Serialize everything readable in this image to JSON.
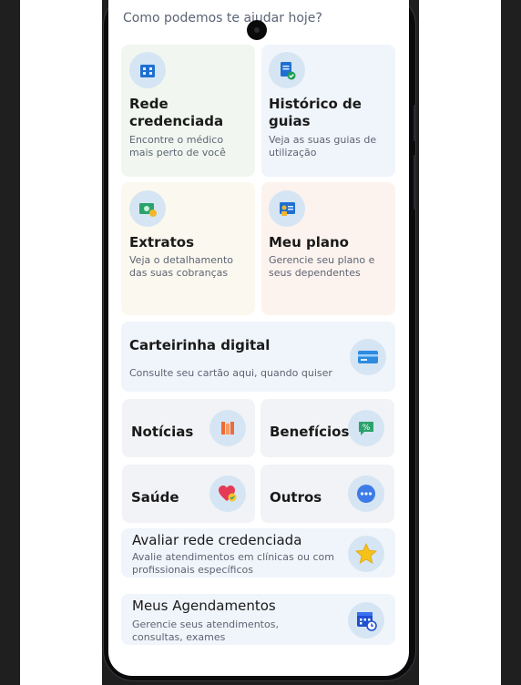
{
  "greeting": "Como podemos te ajudar hoje?",
  "cards": {
    "rede": {
      "title": "Rede credenciada",
      "desc": "Encontre o médico mais perto de você",
      "icon": "building-icon"
    },
    "historico": {
      "title": "Histórico de guias",
      "desc": "Veja as suas guias de utilização",
      "icon": "document-check-icon"
    },
    "extratos": {
      "title": "Extratos",
      "desc": "Veja o detalhamento das suas cobranças",
      "icon": "money-icon"
    },
    "plano": {
      "title": "Meu plano",
      "desc": "Gerencie seu plano e seus dependentes",
      "icon": "id-badge-icon"
    },
    "carteirinha": {
      "title": "Carteirinha digital",
      "desc": "Consulte seu cartão aqui, quando quiser",
      "icon": "card-icon"
    },
    "noticias": {
      "title": "Notícias",
      "icon": "news-icon"
    },
    "beneficios": {
      "title": "Benefícios",
      "icon": "discount-icon"
    },
    "saude": {
      "title": "Saúde",
      "icon": "heart-icon"
    },
    "outros": {
      "title": "Outros",
      "icon": "more-icon"
    },
    "avaliar": {
      "title": "Avaliar rede credenciada",
      "desc": "Avalie atendimentos em clínicas ou com profissionais específicos",
      "icon": "star-icon"
    },
    "agendamentos": {
      "title": "Meus Agendamentos",
      "desc": "Gerencie seus atendimentos, consultas, exames",
      "icon": "calendar-clock-icon"
    }
  },
  "colors": {
    "card_blue": "#f0f5fb",
    "card_green": "#f1f7f0",
    "card_yellow": "#fbf9ef",
    "card_peach": "#fcf3ee",
    "card_gray": "#f2f3f6",
    "icon_bg": "#d6e5f3",
    "accent_blue": "#1f6fd1"
  }
}
